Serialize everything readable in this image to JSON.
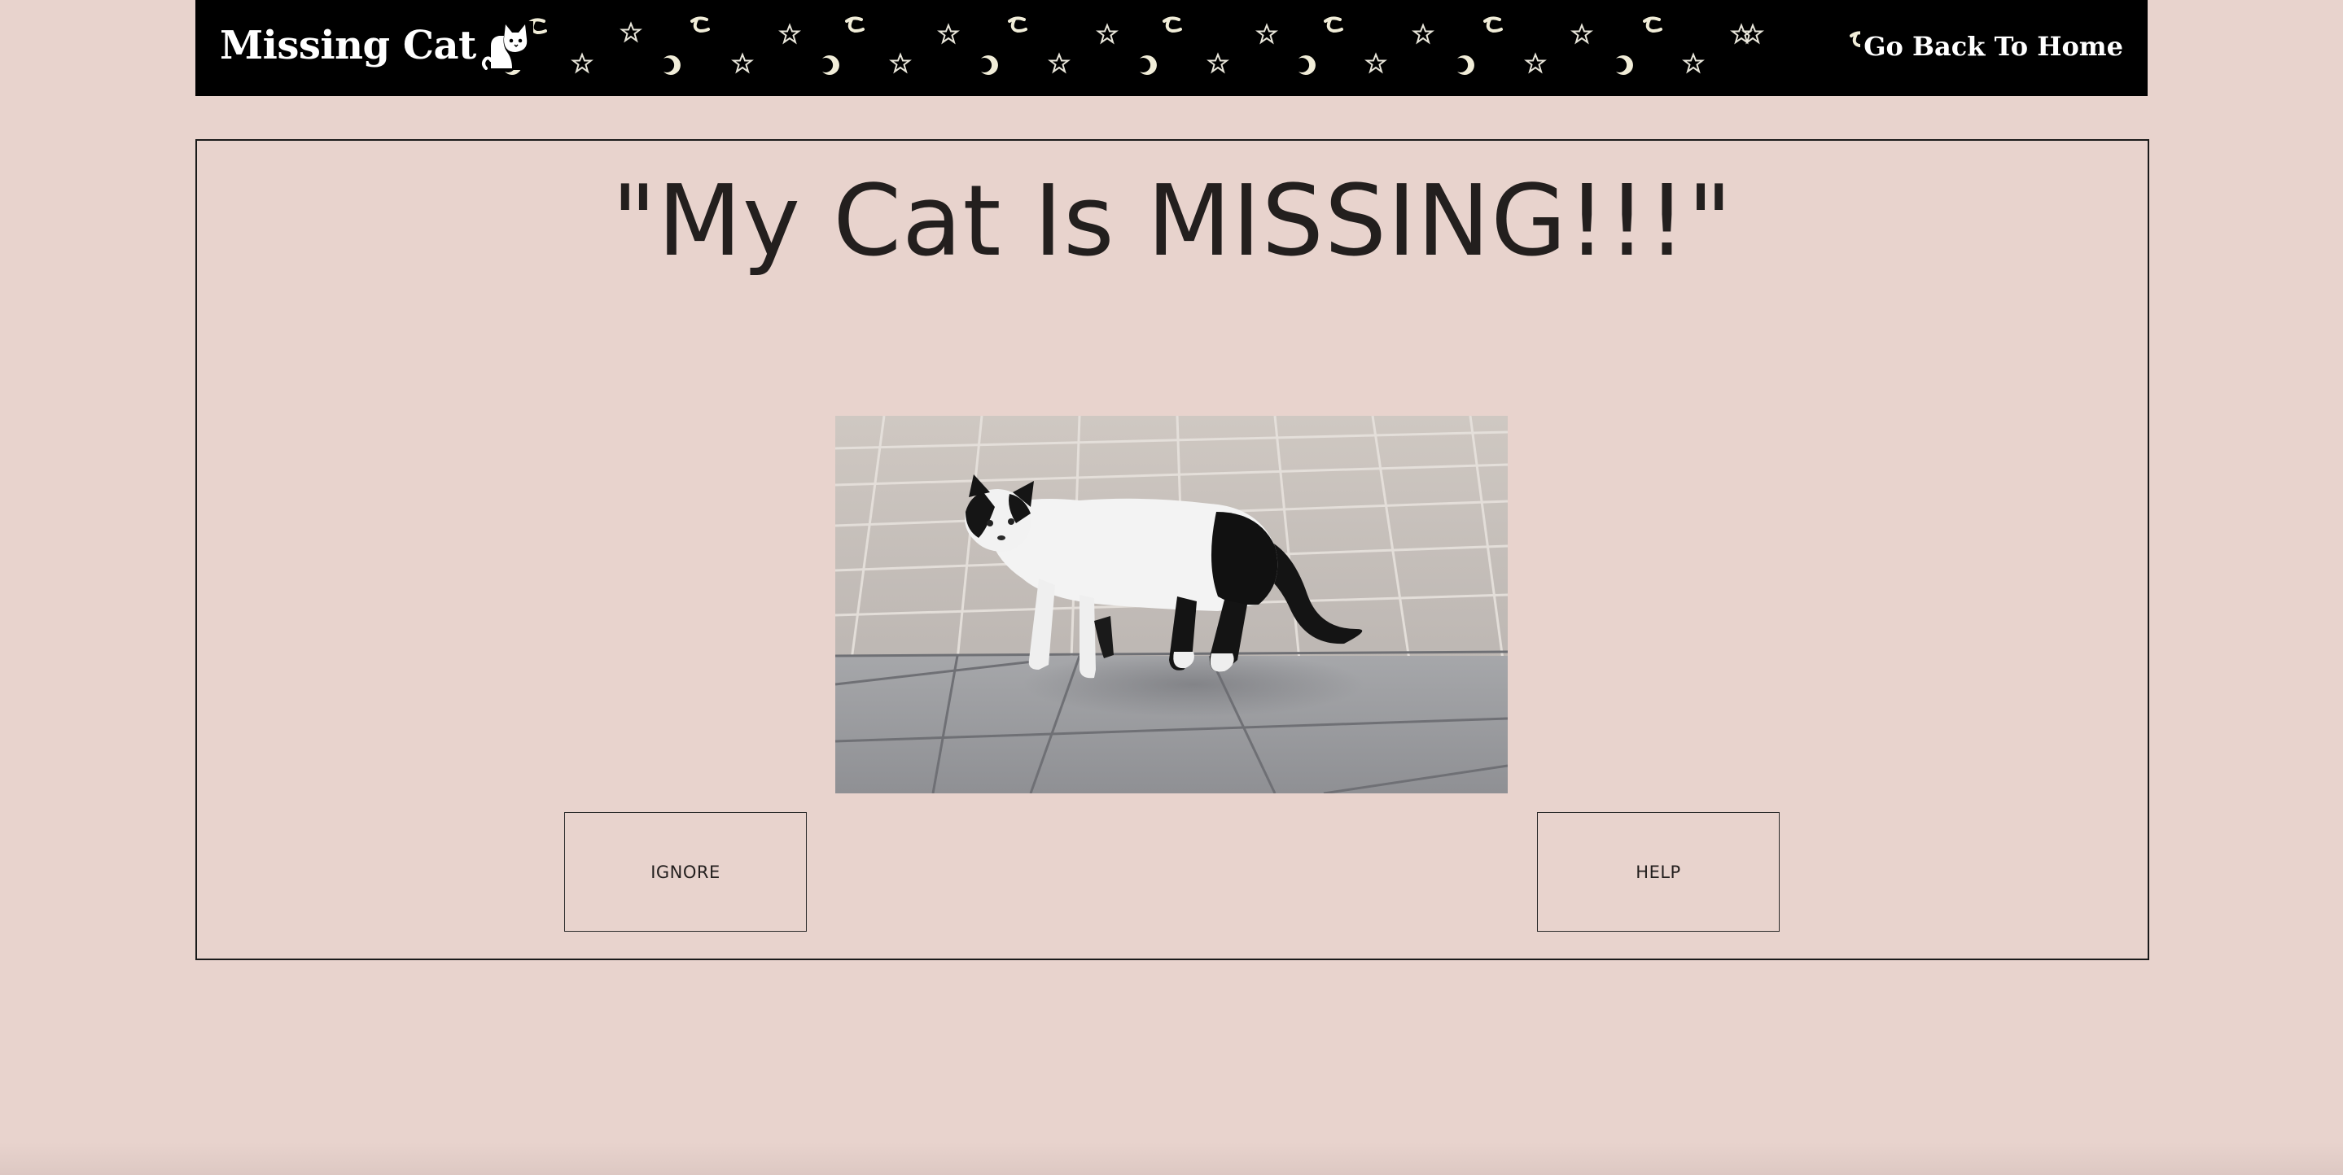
{
  "header": {
    "brand": "Missing Cat",
    "brand_icon": "cat-icon",
    "home_link": "Go Back To Home",
    "background_color": "#000000",
    "pattern_icons": [
      "star-icon",
      "moon-icon"
    ]
  },
  "main": {
    "title": "\"My Cat Is MISSING!!!\"",
    "photo": "black-and-white cat standing on paved tiles",
    "buttons": {
      "ignore_label": "IGNORE",
      "help_label": "HELP"
    }
  },
  "colors": {
    "page_background": "#e8d3cd",
    "text": "#231f1e",
    "header_text": "#ffffff"
  }
}
